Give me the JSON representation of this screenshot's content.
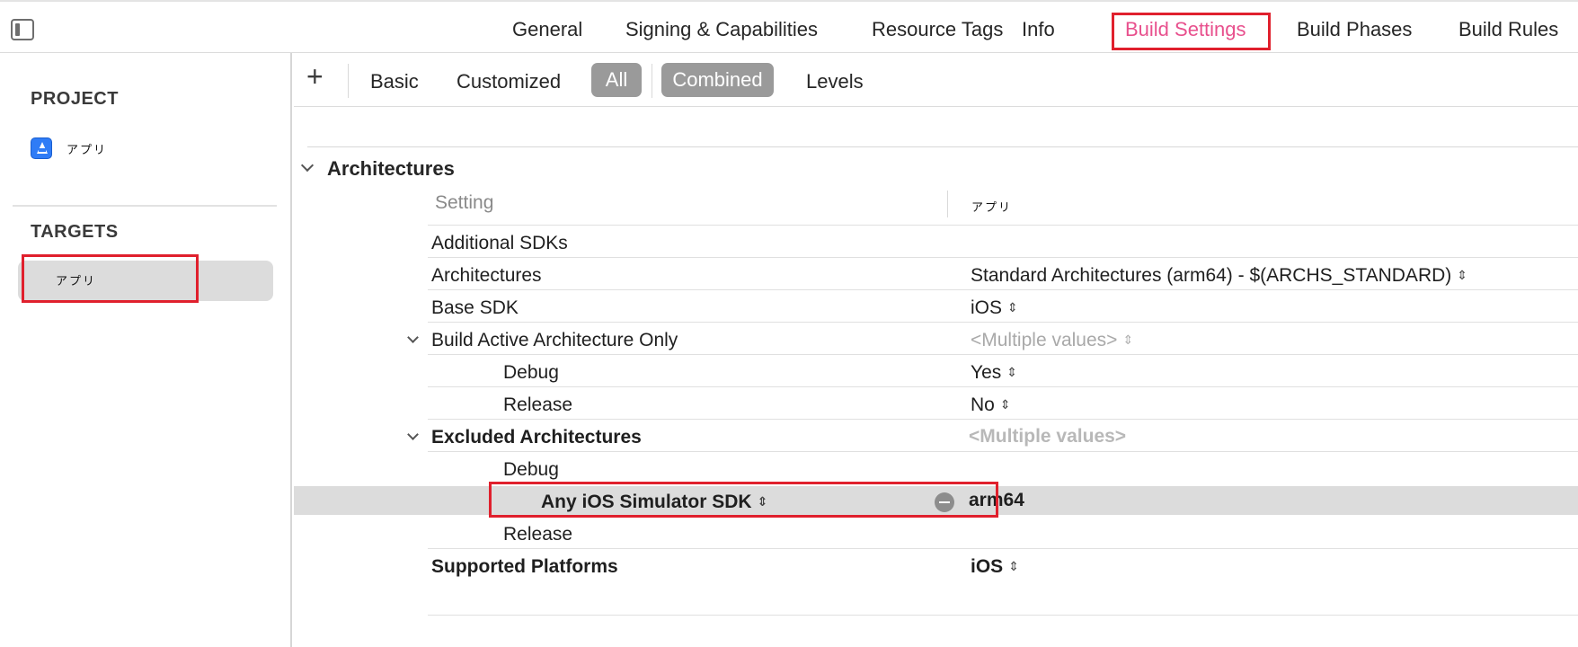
{
  "tabs": {
    "general": "General",
    "signing": "Signing & Capabilities",
    "resource_tags": "Resource Tags",
    "info": "Info",
    "build_settings": "Build Settings",
    "build_phases": "Build Phases",
    "build_rules": "Build Rules",
    "active": "Build Settings",
    "active_color": "#e8508d"
  },
  "sidebar": {
    "project_header": "PROJECT",
    "project_name": "アプリ",
    "targets_header": "TARGETS",
    "target_name": "アプリ"
  },
  "filterbar": {
    "add": "+",
    "basic": "Basic",
    "customized": "Customized",
    "all": "All",
    "combined": "Combined",
    "levels": "Levels"
  },
  "section": {
    "title": "Architectures",
    "col_setting": "Setting",
    "col_target": "アプリ"
  },
  "rows": {
    "additional_sdks": {
      "label": "Additional SDKs",
      "value": ""
    },
    "architectures": {
      "label": "Architectures",
      "value": "Standard Architectures (arm64)  -  $(ARCHS_STANDARD)"
    },
    "base_sdk": {
      "label": "Base SDK",
      "value": "iOS"
    },
    "build_active": {
      "label": "Build Active Architecture Only",
      "value": "<Multiple values>"
    },
    "build_active_debug": {
      "label": "Debug",
      "value": "Yes"
    },
    "build_active_release": {
      "label": "Release",
      "value": "No"
    },
    "excluded": {
      "label": "Excluded Architectures",
      "value": "<Multiple values>"
    },
    "excluded_debug": {
      "label": "Debug",
      "value": ""
    },
    "excluded_debug_sdk": {
      "label": "Any iOS Simulator SDK",
      "value": "arm64"
    },
    "excluded_release": {
      "label": "Release",
      "value": ""
    },
    "supported_platforms": {
      "label": "Supported Platforms",
      "value": "iOS"
    }
  },
  "colors": {
    "highlight": "#e0202d",
    "selected_row": "#dcdcdc",
    "pill": "#9a9a9a"
  }
}
